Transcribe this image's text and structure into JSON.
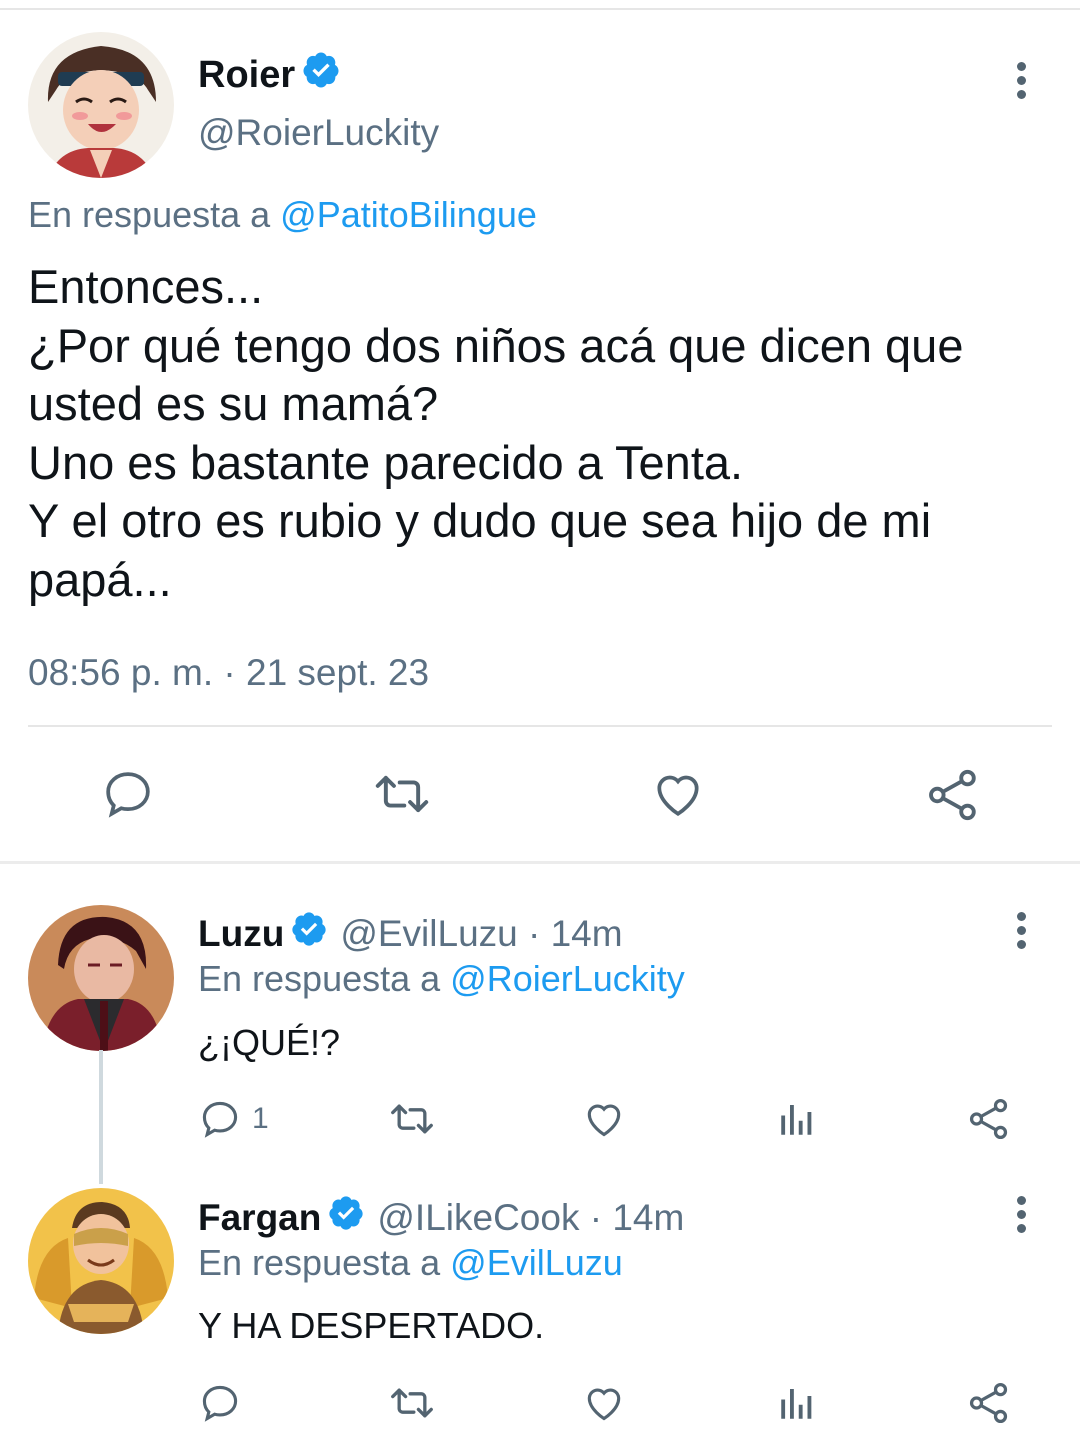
{
  "main_tweet": {
    "name": "Roier",
    "handle": "@RoierLuckity",
    "reply_prefix": "En respuesta a",
    "reply_handle": "@PatitoBilingue",
    "text_lines": [
      "Entonces...",
      "¿Por qué tengo dos niños acá que dicen que",
      "usted es su mamá?",
      "Uno es bastante parecido a Tenta.",
      "Y el otro es rubio y dudo que sea hijo de mi",
      "papá..."
    ],
    "timestamp": "08:56 p. m. · 21 sept. 23",
    "icons": [
      "reply-icon",
      "retweet-icon",
      "like-icon",
      "share-icon"
    ]
  },
  "replies": [
    {
      "name": "Luzu",
      "handle": "@EvilLuzu · 14m",
      "reply_prefix": "En respuesta a",
      "reply_handle": "@RoierLuckity",
      "text": "¿¡QUÉ!?",
      "reply_count": "1"
    },
    {
      "name": "Fargan",
      "handle": "@ILikeCook · 14m",
      "reply_prefix": "En respuesta a",
      "reply_handle": "@EvilLuzu",
      "text": "Y HA DESPERTADO.",
      "reply_count": ""
    }
  ],
  "colors": {
    "accent": "#1d9bf0",
    "muted_text": "#5b7083",
    "icon": "#536471",
    "verified": "#1d9bf0"
  }
}
